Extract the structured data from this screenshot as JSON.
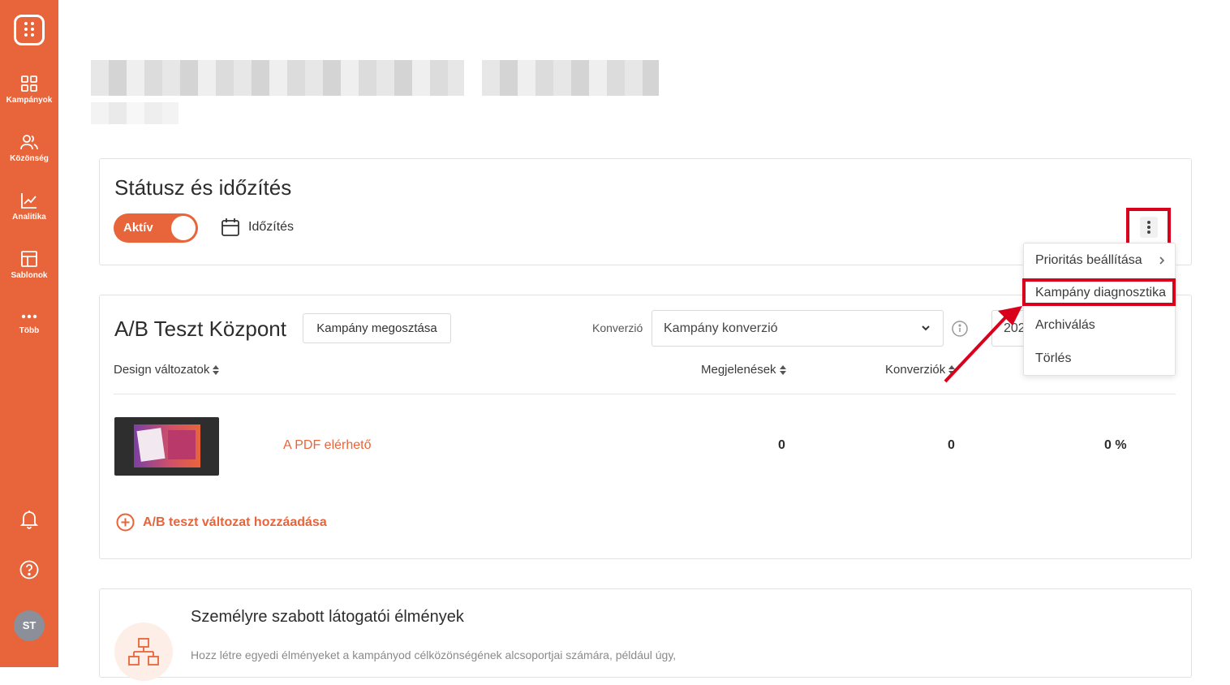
{
  "sidebar": {
    "items": [
      {
        "label": "Kampányok",
        "icon": "grid-icon"
      },
      {
        "label": "Közönség",
        "icon": "users-icon"
      },
      {
        "label": "Analitika",
        "icon": "chart-line-icon"
      },
      {
        "label": "Sablonok",
        "icon": "layout-icon"
      },
      {
        "label": "Több",
        "icon": "more-dots-icon"
      }
    ],
    "bottom": {
      "notifications_icon": "bell-icon",
      "help_icon": "help-circle-icon",
      "avatar_initials": "ST"
    },
    "accent_color": "#e8643a"
  },
  "status_card": {
    "title": "Státusz és időzítés",
    "toggle_label": "Aktív",
    "toggle_on": true,
    "schedule_label": "Időzítés"
  },
  "context_menu": {
    "items": [
      {
        "label": "Prioritás beállítása",
        "has_submenu": true
      },
      {
        "label": "Kampány diagnosztika",
        "highlighted": true
      },
      {
        "label": "Archiválás"
      },
      {
        "label": "Törlés"
      }
    ]
  },
  "ab_card": {
    "title": "A/B Teszt Központ",
    "share_button": "Kampány megosztása",
    "conversion_label": "Konverzió",
    "conversion_select": "Kampány konverzió",
    "date_value": "202",
    "columns": [
      "Design változatok",
      "Megjelenések",
      "Konverziók"
    ],
    "rows": [
      {
        "name": "A PDF elérhető",
        "impressions": "0",
        "conversions": "0",
        "rate": "0 %"
      }
    ],
    "add_variant": "A/B teszt változat hozzáadása"
  },
  "personal_card": {
    "title": "Személyre szabott látogatói élmények",
    "description": "Hozz létre egyedi élményeket a kampányod célközönségének alcsoportjai számára, például úgy,"
  }
}
